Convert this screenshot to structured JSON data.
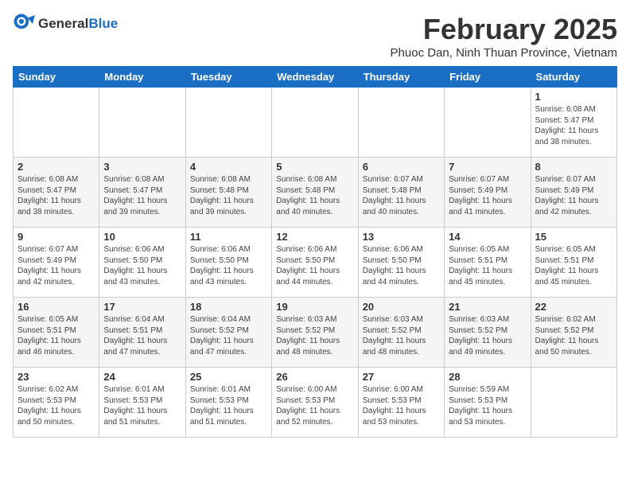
{
  "header": {
    "logo_general": "General",
    "logo_blue": "Blue",
    "title": "February 2025",
    "subtitle": "Phuoc Dan, Ninh Thuan Province, Vietnam"
  },
  "weekdays": [
    "Sunday",
    "Monday",
    "Tuesday",
    "Wednesday",
    "Thursday",
    "Friday",
    "Saturday"
  ],
  "weeks": [
    [
      {
        "day": "",
        "info": ""
      },
      {
        "day": "",
        "info": ""
      },
      {
        "day": "",
        "info": ""
      },
      {
        "day": "",
        "info": ""
      },
      {
        "day": "",
        "info": ""
      },
      {
        "day": "",
        "info": ""
      },
      {
        "day": "1",
        "info": "Sunrise: 6:08 AM\nSunset: 5:47 PM\nDaylight: 11 hours\nand 38 minutes."
      }
    ],
    [
      {
        "day": "2",
        "info": "Sunrise: 6:08 AM\nSunset: 5:47 PM\nDaylight: 11 hours\nand 38 minutes."
      },
      {
        "day": "3",
        "info": "Sunrise: 6:08 AM\nSunset: 5:47 PM\nDaylight: 11 hours\nand 39 minutes."
      },
      {
        "day": "4",
        "info": "Sunrise: 6:08 AM\nSunset: 5:48 PM\nDaylight: 11 hours\nand 39 minutes."
      },
      {
        "day": "5",
        "info": "Sunrise: 6:08 AM\nSunset: 5:48 PM\nDaylight: 11 hours\nand 40 minutes."
      },
      {
        "day": "6",
        "info": "Sunrise: 6:07 AM\nSunset: 5:48 PM\nDaylight: 11 hours\nand 40 minutes."
      },
      {
        "day": "7",
        "info": "Sunrise: 6:07 AM\nSunset: 5:49 PM\nDaylight: 11 hours\nand 41 minutes."
      },
      {
        "day": "8",
        "info": "Sunrise: 6:07 AM\nSunset: 5:49 PM\nDaylight: 11 hours\nand 42 minutes."
      }
    ],
    [
      {
        "day": "9",
        "info": "Sunrise: 6:07 AM\nSunset: 5:49 PM\nDaylight: 11 hours\nand 42 minutes."
      },
      {
        "day": "10",
        "info": "Sunrise: 6:06 AM\nSunset: 5:50 PM\nDaylight: 11 hours\nand 43 minutes."
      },
      {
        "day": "11",
        "info": "Sunrise: 6:06 AM\nSunset: 5:50 PM\nDaylight: 11 hours\nand 43 minutes."
      },
      {
        "day": "12",
        "info": "Sunrise: 6:06 AM\nSunset: 5:50 PM\nDaylight: 11 hours\nand 44 minutes."
      },
      {
        "day": "13",
        "info": "Sunrise: 6:06 AM\nSunset: 5:50 PM\nDaylight: 11 hours\nand 44 minutes."
      },
      {
        "day": "14",
        "info": "Sunrise: 6:05 AM\nSunset: 5:51 PM\nDaylight: 11 hours\nand 45 minutes."
      },
      {
        "day": "15",
        "info": "Sunrise: 6:05 AM\nSunset: 5:51 PM\nDaylight: 11 hours\nand 45 minutes."
      }
    ],
    [
      {
        "day": "16",
        "info": "Sunrise: 6:05 AM\nSunset: 5:51 PM\nDaylight: 11 hours\nand 46 minutes."
      },
      {
        "day": "17",
        "info": "Sunrise: 6:04 AM\nSunset: 5:51 PM\nDaylight: 11 hours\nand 47 minutes."
      },
      {
        "day": "18",
        "info": "Sunrise: 6:04 AM\nSunset: 5:52 PM\nDaylight: 11 hours\nand 47 minutes."
      },
      {
        "day": "19",
        "info": "Sunrise: 6:03 AM\nSunset: 5:52 PM\nDaylight: 11 hours\nand 48 minutes."
      },
      {
        "day": "20",
        "info": "Sunrise: 6:03 AM\nSunset: 5:52 PM\nDaylight: 11 hours\nand 48 minutes."
      },
      {
        "day": "21",
        "info": "Sunrise: 6:03 AM\nSunset: 5:52 PM\nDaylight: 11 hours\nand 49 minutes."
      },
      {
        "day": "22",
        "info": "Sunrise: 6:02 AM\nSunset: 5:52 PM\nDaylight: 11 hours\nand 50 minutes."
      }
    ],
    [
      {
        "day": "23",
        "info": "Sunrise: 6:02 AM\nSunset: 5:53 PM\nDaylight: 11 hours\nand 50 minutes."
      },
      {
        "day": "24",
        "info": "Sunrise: 6:01 AM\nSunset: 5:53 PM\nDaylight: 11 hours\nand 51 minutes."
      },
      {
        "day": "25",
        "info": "Sunrise: 6:01 AM\nSunset: 5:53 PM\nDaylight: 11 hours\nand 51 minutes."
      },
      {
        "day": "26",
        "info": "Sunrise: 6:00 AM\nSunset: 5:53 PM\nDaylight: 11 hours\nand 52 minutes."
      },
      {
        "day": "27",
        "info": "Sunrise: 6:00 AM\nSunset: 5:53 PM\nDaylight: 11 hours\nand 53 minutes."
      },
      {
        "day": "28",
        "info": "Sunrise: 5:59 AM\nSunset: 5:53 PM\nDaylight: 11 hours\nand 53 minutes."
      },
      {
        "day": "",
        "info": ""
      }
    ]
  ]
}
